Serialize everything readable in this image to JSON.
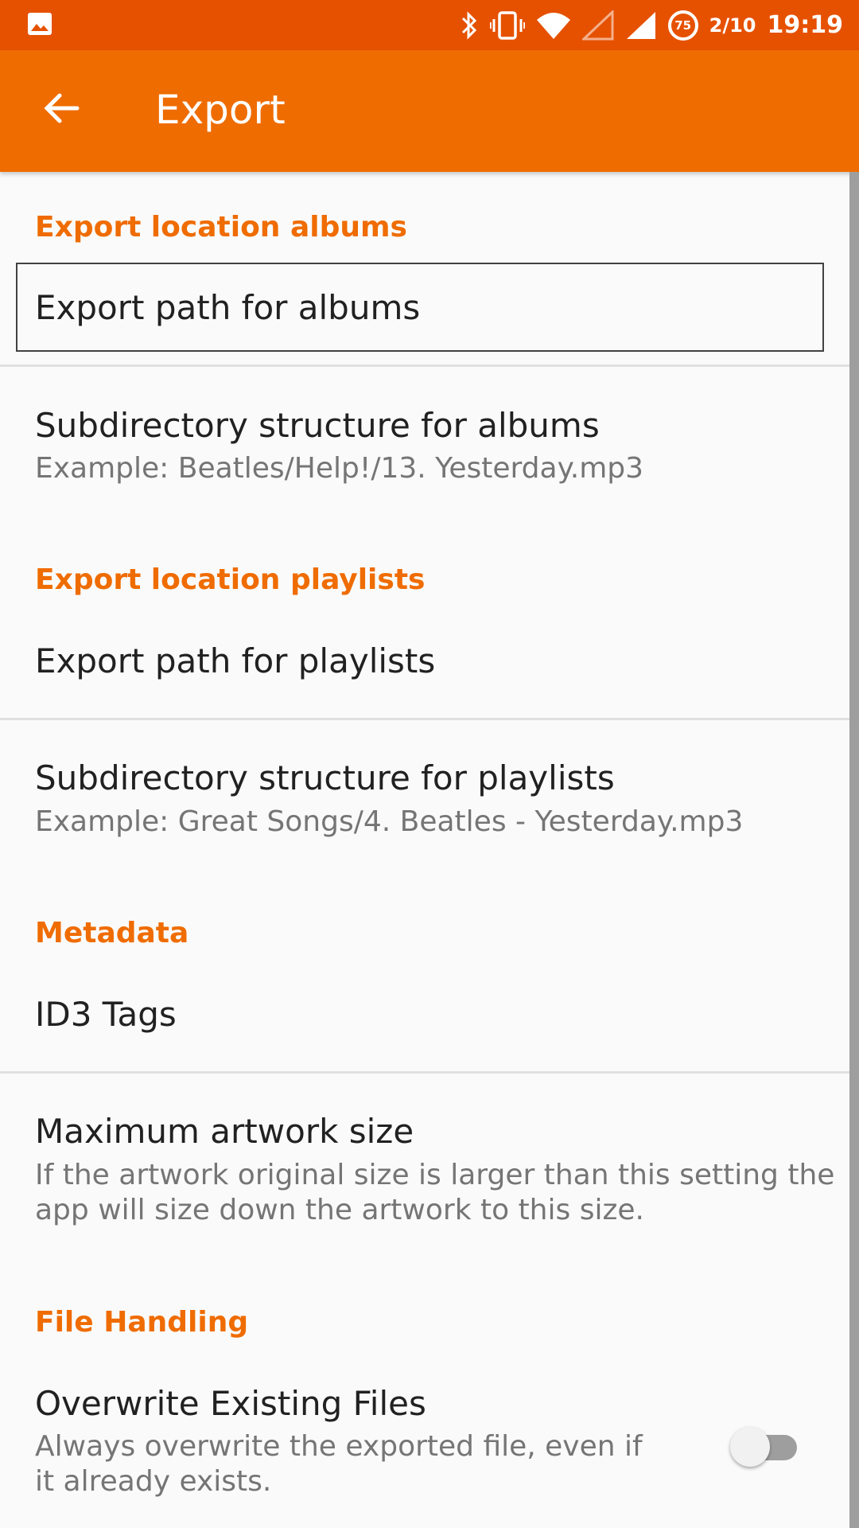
{
  "status_bar": {
    "battery_level": "75",
    "date": "2/10",
    "time": "19:19",
    "icons": [
      "image-icon",
      "bluetooth-icon",
      "vibrate-icon",
      "wifi-icon",
      "signal-empty-icon",
      "signal-full-icon",
      "battery-icon"
    ]
  },
  "app_bar": {
    "title": "Export",
    "back_icon": "arrow-left-icon",
    "color": "#ef6c00"
  },
  "sections": [
    {
      "category": "Export location albums",
      "items": [
        {
          "title": "Export path for albums",
          "summary": ""
        },
        {
          "title": "Subdirectory structure for albums",
          "summary": "Example: Beatles/Help!/13. Yesterday.mp3"
        }
      ]
    },
    {
      "category": "Export location playlists",
      "items": [
        {
          "title": "Export path for playlists",
          "summary": ""
        },
        {
          "title": "Subdirectory structure for playlists",
          "summary": "Example: Great Songs/4. Beatles - Yesterday.mp3"
        }
      ]
    },
    {
      "category": "Metadata",
      "items": [
        {
          "title": "ID3 Tags",
          "summary": ""
        },
        {
          "title": "Maximum artwork size",
          "summary": "If the artwork original size is larger than this setting the app will size down the artwork to this size."
        }
      ]
    },
    {
      "category": "File Handling",
      "items": [
        {
          "title": "Overwrite Existing Files",
          "summary": "Always overwrite the exported file, even if it already exists.",
          "toggle": false
        }
      ]
    }
  ],
  "colors": {
    "accent": "#ef6c00",
    "status_bar": "#e65100"
  }
}
